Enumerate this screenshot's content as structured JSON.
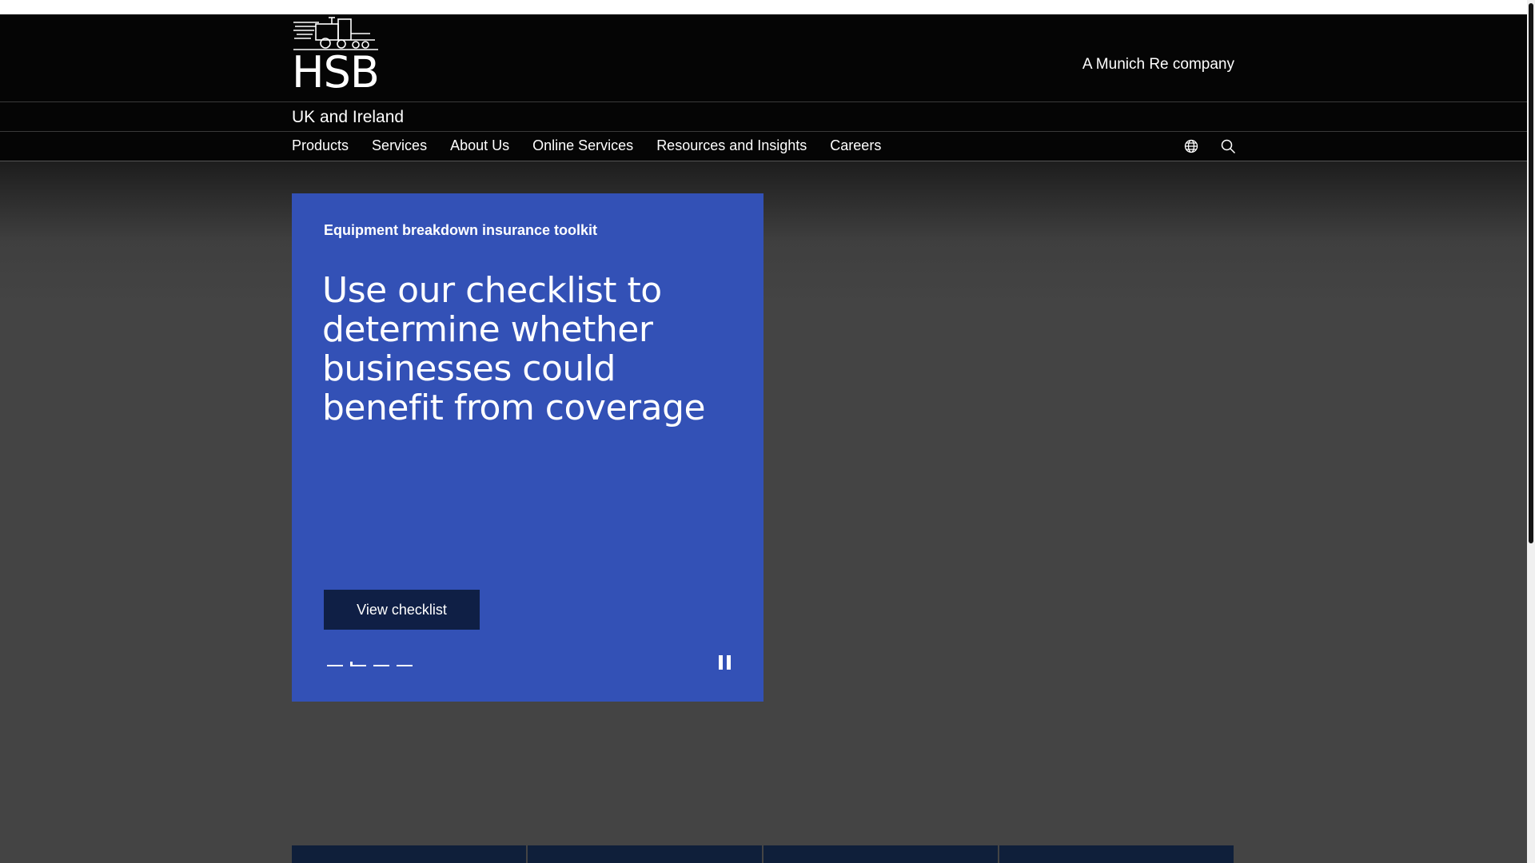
{
  "header": {
    "logo_text": "HSB",
    "tagline": "A Munich Re company"
  },
  "region": {
    "label": "UK and Ireland"
  },
  "nav": {
    "items": [
      {
        "label": "Products"
      },
      {
        "label": "Services"
      },
      {
        "label": "About Us"
      },
      {
        "label": "Online Services"
      },
      {
        "label": "Resources and Insights"
      },
      {
        "label": "Careers"
      }
    ],
    "icons": [
      "globe-icon",
      "search-icon"
    ]
  },
  "hero": {
    "eyebrow": "Equipment breakdown insurance toolkit",
    "title": "Use our checklist to determine whether businesses could benefit from coverage",
    "button_label": "View checklist",
    "slides_count": 4,
    "active_slide": 2,
    "colors": {
      "card": "#3351b6",
      "button": "#0f1f45",
      "background": "#444444"
    }
  }
}
